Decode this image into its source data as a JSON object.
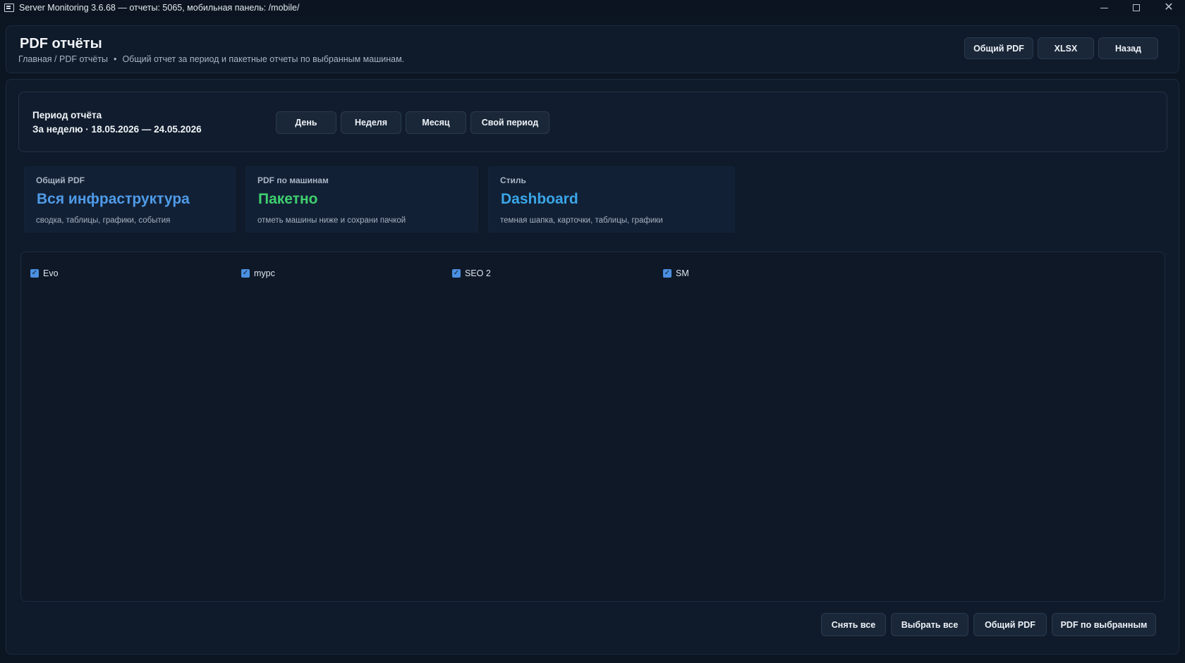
{
  "window": {
    "title": "Server Monitoring 3.6.68 — отчеты: 5065, мобильная панель: /mobile/"
  },
  "header": {
    "title": "PDF отчёты",
    "breadcrumb": "Главная / PDF отчёты",
    "dot": "•",
    "description": "Общий отчет за период и пакетные отчеты по выбранным машинам.",
    "buttons": [
      "Общий PDF",
      "XLSX",
      "Назад"
    ]
  },
  "period": {
    "label": "Период отчёта",
    "value": "За неделю · 18.05.2026 — 24.05.2026",
    "buttons": [
      "День",
      "Неделя",
      "Месяц",
      "Свой период"
    ]
  },
  "cards": [
    {
      "label": "Общий PDF",
      "value": "Вся инфраструктура",
      "desc": "сводка, таблицы, графики, события",
      "color": "#4f9be8"
    },
    {
      "label": "PDF по машинам",
      "value": "Пакетно",
      "desc": "отметь машины ниже и сохрани пачкой",
      "color": "#3fcf6e"
    },
    {
      "label": "Стиль",
      "value": "Dashboard",
      "desc": "темная шапка, карточки, таблицы, графики",
      "color": "#3aa6e8"
    }
  ],
  "machines": [
    {
      "name": "Evo",
      "checked": true
    },
    {
      "name": "mypc",
      "checked": true
    },
    {
      "name": "SEO 2",
      "checked": true
    },
    {
      "name": "SM",
      "checked": true
    }
  ],
  "footer": {
    "buttons": [
      "Снять все",
      "Выбрать все",
      "Общий PDF",
      "PDF по выбранным"
    ]
  },
  "colors": {
    "background": "#0c1522",
    "panel": "#0f1a2a",
    "checkbox": "#4b8fe0"
  }
}
